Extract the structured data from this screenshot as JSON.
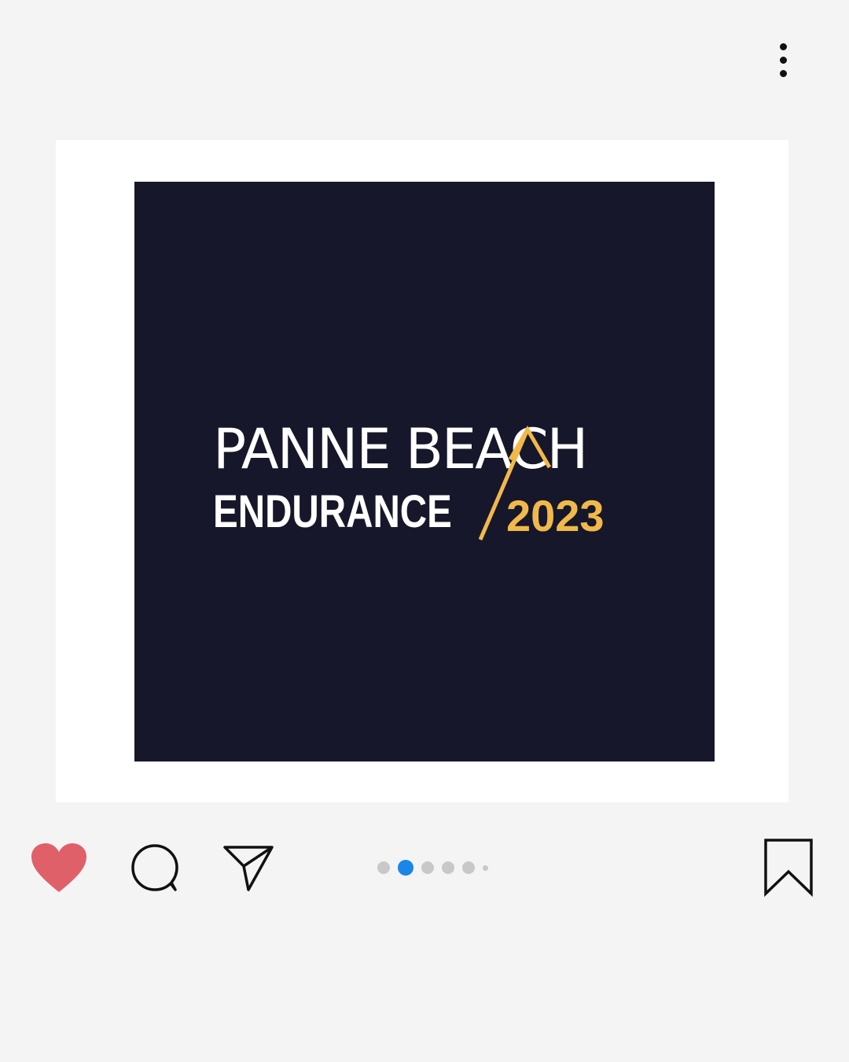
{
  "header": {
    "more_icon": "more-vertical-icon"
  },
  "post": {
    "logo": {
      "line1": "PANNE BEACH",
      "line2": "ENDURANCE",
      "year": "2023"
    },
    "colors": {
      "image_background": "#16172a",
      "logo_text": "#ffffff",
      "logo_accent": "#f1b94a"
    }
  },
  "actions": {
    "like_icon": "heart-icon",
    "like_color": "#e0606a",
    "liked": true,
    "comment_icon": "comment-icon",
    "share_icon": "send-icon",
    "save_icon": "bookmark-icon"
  },
  "pagination": {
    "total_visible": 6,
    "active_index": 2,
    "active_color": "#1a86e8",
    "inactive_color": "#c8c8c8"
  }
}
